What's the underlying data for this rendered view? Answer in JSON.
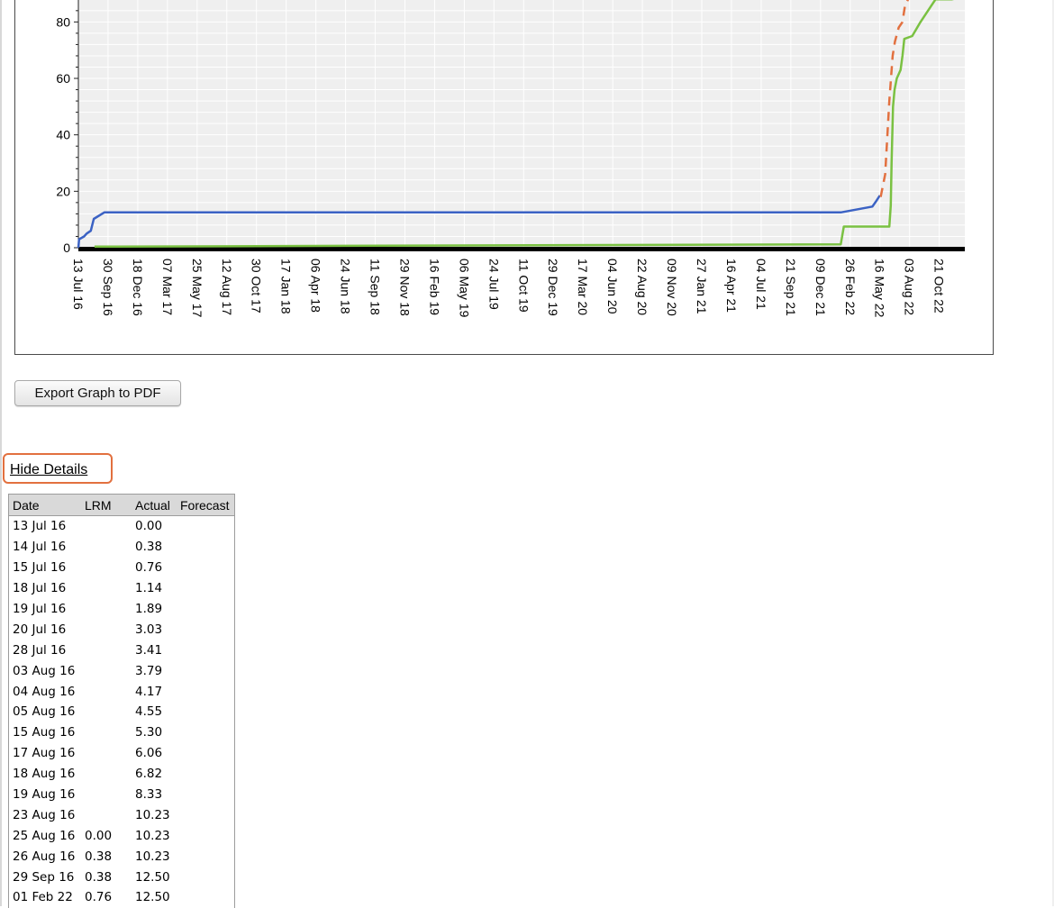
{
  "chart_data": {
    "type": "line",
    "y_ticks": [
      0,
      20,
      40,
      60,
      80
    ],
    "ylim": [
      0,
      88
    ],
    "x_tick_labels": [
      "13 Jul 16",
      "30 Sep 16",
      "18 Dec 16",
      "07 Mar 17",
      "25 May 17",
      "12 Aug 17",
      "30 Oct 17",
      "17 Jan 18",
      "06 Apr 18",
      "24 Jun 18",
      "11 Sep 18",
      "29 Nov 18",
      "16 Feb 19",
      "06 May 19",
      "24 Jul 19",
      "11 Oct 19",
      "29 Dec 19",
      "17 Mar 20",
      "04 Jun 20",
      "22 Aug 20",
      "09 Nov 20",
      "27 Jan 21",
      "16 Apr 21",
      "04 Jul 21",
      "21 Sep 21",
      "09 Dec 21",
      "26 Feb 22",
      "16 May 22",
      "03 Aug 22",
      "21 Oct 22"
    ],
    "x_tick_step_days": 79,
    "xlim": [
      "13 Jul 16",
      "28 Dec 22"
    ],
    "grid": true,
    "series": [
      {
        "color": "#3b62c4",
        "style": "solid",
        "points": [
          [
            "13 Jul 16",
            0
          ],
          [
            "15 Jul 16",
            3
          ],
          [
            "28 Jul 16",
            4
          ],
          [
            "04 Aug 16",
            5
          ],
          [
            "15 Aug 16",
            6
          ],
          [
            "23 Aug 16",
            10.2
          ],
          [
            "20 Sep 16",
            12.5
          ],
          [
            "01 Feb 22",
            12.5
          ],
          [
            "15 Apr 22",
            14.3
          ],
          [
            "26 Apr 22",
            14.6
          ],
          [
            "06 May 22",
            16.5
          ],
          [
            "16 May 22",
            18.5
          ]
        ]
      },
      {
        "color": "#e2703f",
        "style": "dashed",
        "points": [
          [
            "18 May 22",
            18
          ],
          [
            "30 May 22",
            26
          ],
          [
            "10 Jun 22",
            52
          ],
          [
            "19 Jun 22",
            68
          ],
          [
            "25 Jun 22",
            73
          ],
          [
            "05 Jul 22",
            78
          ],
          [
            "15 Jul 22",
            80
          ],
          [
            "22 Jul 22",
            86
          ],
          [
            "03 Aug 22",
            89
          ]
        ]
      },
      {
        "color": "#7ac142",
        "style": "solid",
        "points": [
          [
            "25 Aug 16",
            0.38
          ],
          [
            "01 Feb 22",
            1.2
          ],
          [
            "09 Feb 22",
            7.5
          ],
          [
            "10 Jun 22",
            7.5
          ],
          [
            "14 Jun 22",
            15
          ],
          [
            "16 Jun 22",
            30
          ],
          [
            "20 Jun 22",
            50
          ],
          [
            "24 Jun 22",
            56
          ],
          [
            "30 Jun 22",
            60
          ],
          [
            "10 Jul 22",
            63
          ],
          [
            "15 Jul 22",
            68
          ],
          [
            "20 Jul 22",
            74
          ],
          [
            "10 Aug 22",
            75
          ],
          [
            "01 Sep 22",
            80
          ],
          [
            "01 Oct 22",
            86
          ],
          [
            "11 Oct 22",
            88
          ],
          [
            "23 Nov 22",
            88
          ],
          [
            "28 Dec 22",
            90
          ]
        ]
      }
    ]
  },
  "export_button": {
    "label": "Export Graph to PDF"
  },
  "details_toggle": {
    "label": "Hide Details"
  },
  "details_table": {
    "columns": [
      "Date",
      "LRM",
      "Actual",
      "Forecast"
    ],
    "rows": [
      [
        "13 Jul 16",
        "",
        "0.00",
        ""
      ],
      [
        "14 Jul 16",
        "",
        "0.38",
        ""
      ],
      [
        "15 Jul 16",
        "",
        "0.76",
        ""
      ],
      [
        "18 Jul 16",
        "",
        "1.14",
        ""
      ],
      [
        "19 Jul 16",
        "",
        "1.89",
        ""
      ],
      [
        "20 Jul 16",
        "",
        "3.03",
        ""
      ],
      [
        "28 Jul 16",
        "",
        "3.41",
        ""
      ],
      [
        "03 Aug 16",
        "",
        "3.79",
        ""
      ],
      [
        "04 Aug 16",
        "",
        "4.17",
        ""
      ],
      [
        "05 Aug 16",
        "",
        "4.55",
        ""
      ],
      [
        "15 Aug 16",
        "",
        "5.30",
        ""
      ],
      [
        "17 Aug 16",
        "",
        "6.06",
        ""
      ],
      [
        "18 Aug 16",
        "",
        "6.82",
        ""
      ],
      [
        "19 Aug 16",
        "",
        "8.33",
        ""
      ],
      [
        "23 Aug 16",
        "",
        "10.23",
        ""
      ],
      [
        "25 Aug 16",
        "0.00",
        "10.23",
        ""
      ],
      [
        "26 Aug 16",
        "0.38",
        "10.23",
        ""
      ],
      [
        "29 Sep 16",
        "0.38",
        "12.50",
        ""
      ],
      [
        "01 Feb 22",
        "0.76",
        "12.50",
        ""
      ]
    ]
  }
}
